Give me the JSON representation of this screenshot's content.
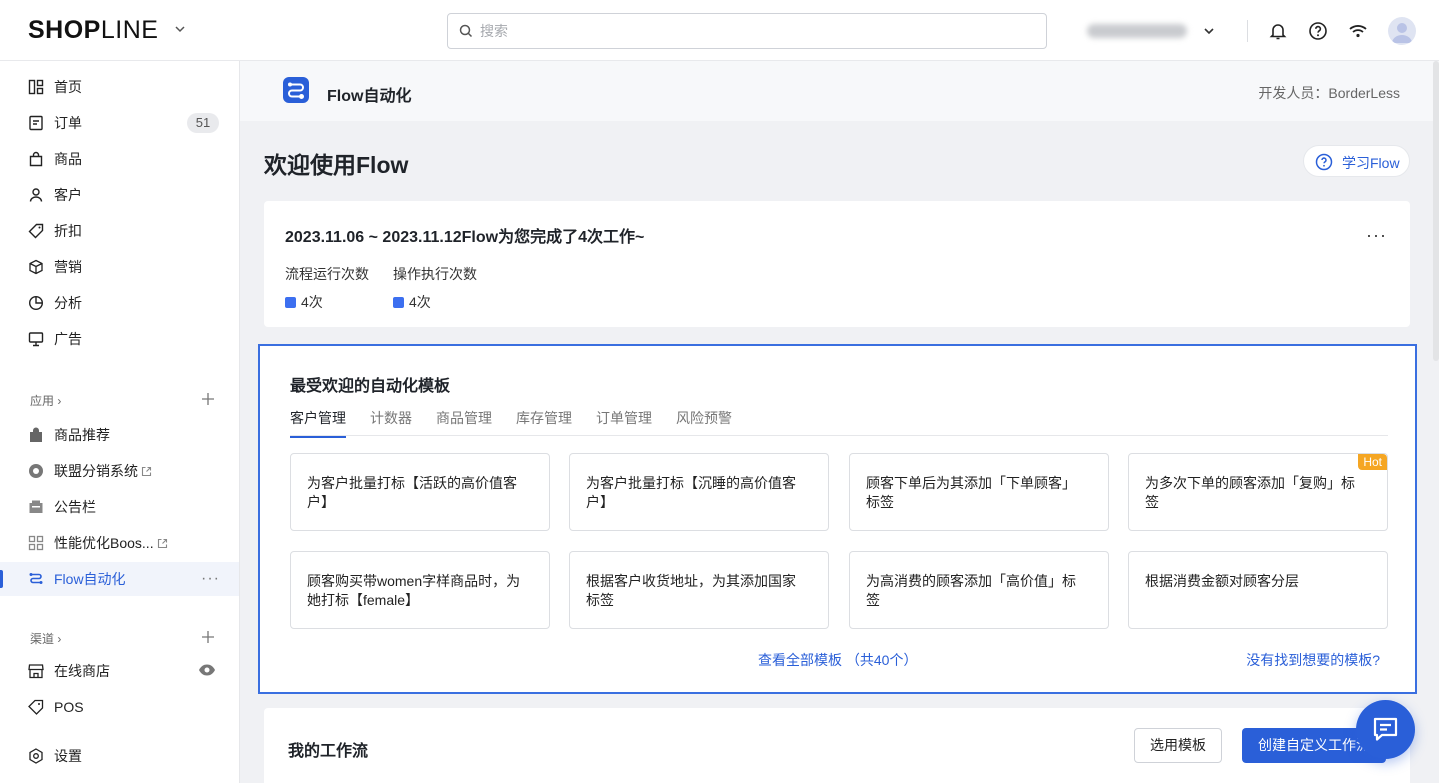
{
  "header": {
    "logo_bold": "SHOP",
    "logo_thin": "LINE",
    "search_placeholder": "搜索",
    "store_name_blurred": "赛加德店铺04"
  },
  "sidebar": {
    "items": [
      {
        "label": "首页",
        "icon": "home-icon"
      },
      {
        "label": "订单",
        "icon": "order-icon",
        "badge": "51"
      },
      {
        "label": "商品",
        "icon": "product-bag-icon"
      },
      {
        "label": "客户",
        "icon": "customer-icon"
      },
      {
        "label": "折扣",
        "icon": "discount-tag-icon"
      },
      {
        "label": "营销",
        "icon": "marketing-cube-icon"
      },
      {
        "label": "分析",
        "icon": "analytics-pie-icon"
      },
      {
        "label": "广告",
        "icon": "ads-monitor-icon"
      }
    ],
    "apps_heading": "应用",
    "apps": [
      {
        "label": "商品推荐",
        "icon": "recommend-icon"
      },
      {
        "label": "联盟分销系统",
        "icon": "affiliate-icon",
        "external": true
      },
      {
        "label": "公告栏",
        "icon": "bulletin-icon"
      },
      {
        "label": "性能优化Boos...",
        "icon": "performance-icon",
        "external": true
      },
      {
        "label": "Flow自动化",
        "icon": "flow-icon",
        "active": true
      }
    ],
    "channels_heading": "渠道",
    "channels": [
      {
        "label": "在线商店",
        "icon": "online-store-icon"
      },
      {
        "label": "POS",
        "icon": "pos-icon"
      }
    ],
    "settings_label": "设置"
  },
  "page": {
    "app_title": "Flow自动化",
    "developer": "开发人员：BorderLess",
    "welcome": "欢迎使用Flow",
    "learn_button": "学习Flow"
  },
  "stats": {
    "title": "2023.11.06 ~ 2023.11.12Flow为您完成了4次工作~",
    "items": [
      {
        "label": "流程运行次数",
        "value": "4次"
      },
      {
        "label": "操作执行次数",
        "value": "4次"
      }
    ],
    "accent": "#3c6ff0"
  },
  "templates": {
    "title": "最受欢迎的自动化模板",
    "tabs": [
      "客户管理",
      "计数器",
      "商品管理",
      "库存管理",
      "订单管理",
      "风险预警"
    ],
    "active_tab": "客户管理",
    "tiles": [
      {
        "text": "为客户批量打标【活跃的高价值客户】"
      },
      {
        "text": "为客户批量打标【沉睡的高价值客户】"
      },
      {
        "text": "顾客下单后为其添加「下单顾客」标签"
      },
      {
        "text": "为多次下单的顾客添加「复购」标签",
        "hot": "Hot"
      },
      {
        "text": "顾客购买带women字样商品时，为她打标【female】"
      },
      {
        "text": "根据客户收货地址，为其添加国家标签"
      },
      {
        "text": "为高消费的顾客添加「高价值」标签"
      },
      {
        "text": "根据消费金额对顾客分层"
      }
    ],
    "view_all": "查看全部模板 （共40个）",
    "not_found": "没有找到想要的模板?"
  },
  "workflows": {
    "title": "我的工作流",
    "choose_template": "选用模板",
    "create_custom": "创建自定义工作流"
  },
  "colors": {
    "primary": "#2a5fd8",
    "hot": "#f5a623"
  }
}
